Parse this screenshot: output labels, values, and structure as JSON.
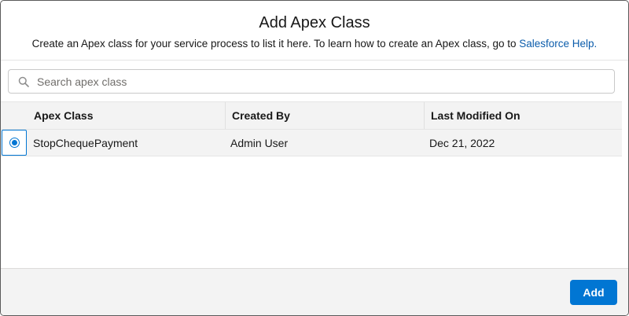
{
  "modal": {
    "title": "Add Apex Class",
    "subtitle": "Create an Apex class for your service process to list it here. To learn how to create an Apex class, go to ",
    "help_link": "Salesforce Help.",
    "accent_color": "#0176d3"
  },
  "search": {
    "placeholder": "Search apex class",
    "value": "",
    "icon": "search-icon"
  },
  "table": {
    "columns": [
      "Apex Class",
      "Created By",
      "Last Modified On"
    ],
    "rows": [
      {
        "selected": true,
        "apex_class": "StopChequePayment",
        "created_by": "Admin User",
        "last_modified_on": "Dec 21, 2022"
      }
    ]
  },
  "footer": {
    "add_label": "Add"
  }
}
